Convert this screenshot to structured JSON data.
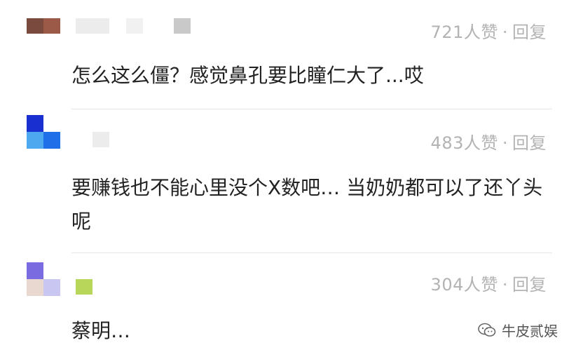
{
  "comments": [
    {
      "likes_label": "721人赞",
      "separator": "·",
      "reply_label": "回复",
      "text": "怎么这么僵？感觉鼻孔要比瞳仁大了...哎"
    },
    {
      "likes_label": "483人赞",
      "separator": "·",
      "reply_label": "回复",
      "text": "要赚钱也不能心里没个X数吧… 当奶奶都可以了还丫头呢"
    },
    {
      "likes_label": "304人赞",
      "separator": "·",
      "reply_label": "回复",
      "text": "蔡明…"
    }
  ],
  "watermark": {
    "icon": "wechat-icon",
    "text": "牛皮贰娱"
  }
}
